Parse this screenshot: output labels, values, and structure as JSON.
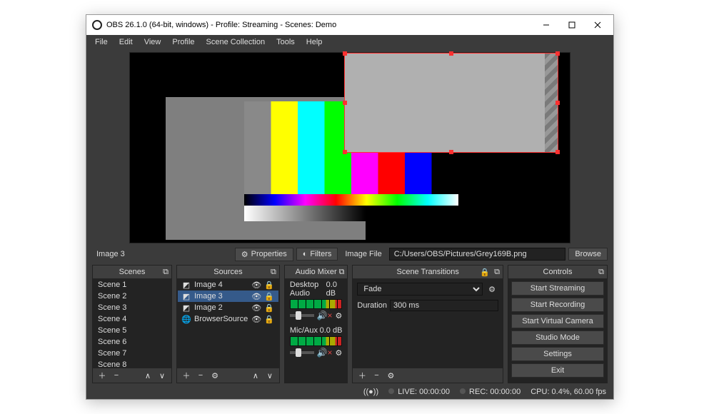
{
  "window": {
    "title": "OBS 26.1.0 (64-bit, windows) - Profile: Streaming - Scenes: Demo"
  },
  "menu": {
    "items": [
      "File",
      "Edit",
      "View",
      "Profile",
      "Scene Collection",
      "Tools",
      "Help"
    ]
  },
  "propbar": {
    "source_name": "Image 3",
    "properties": "Properties",
    "filters": "Filters",
    "field_label": "Image File",
    "field_value": "C:/Users/OBS/Pictures/Grey169B.png",
    "browse": "Browse"
  },
  "docks": {
    "scenes": {
      "title": "Scenes",
      "items": [
        "Scene 1",
        "Scene 2",
        "Scene 3",
        "Scene 4",
        "Scene 5",
        "Scene 6",
        "Scene 7",
        "Scene 8"
      ]
    },
    "sources": {
      "title": "Sources",
      "items": [
        {
          "icon": "image-icon",
          "label": "Image 4",
          "selected": false
        },
        {
          "icon": "image-icon",
          "label": "Image 3",
          "selected": true
        },
        {
          "icon": "image-icon",
          "label": "Image 2",
          "selected": false
        },
        {
          "icon": "globe-icon",
          "label": "BrowserSource",
          "selected": false
        }
      ]
    },
    "mixer": {
      "title": "Audio Mixer",
      "channels": [
        {
          "name": "Desktop Audio",
          "db": "0.0 dB"
        },
        {
          "name": "Mic/Aux",
          "db": "0.0 dB"
        }
      ]
    },
    "transitions": {
      "title": "Scene Transitions",
      "type": "Fade",
      "duration_label": "Duration",
      "duration_value": "300 ms"
    },
    "controls": {
      "title": "Controls",
      "buttons": [
        "Start Streaming",
        "Start Recording",
        "Start Virtual Camera",
        "Studio Mode",
        "Settings",
        "Exit"
      ]
    }
  },
  "status": {
    "live_label": "LIVE:",
    "live_time": "00:00:00",
    "rec_label": "REC:",
    "rec_time": "00:00:00",
    "cpu": "CPU: 0.4%, 60.00 fps"
  },
  "toolbar_icons": {
    "add": "+",
    "remove": "−",
    "gear": "⚙",
    "up": "∧",
    "down": "∨",
    "lock": "🔒",
    "popout": "⧉",
    "eye": "👁"
  }
}
